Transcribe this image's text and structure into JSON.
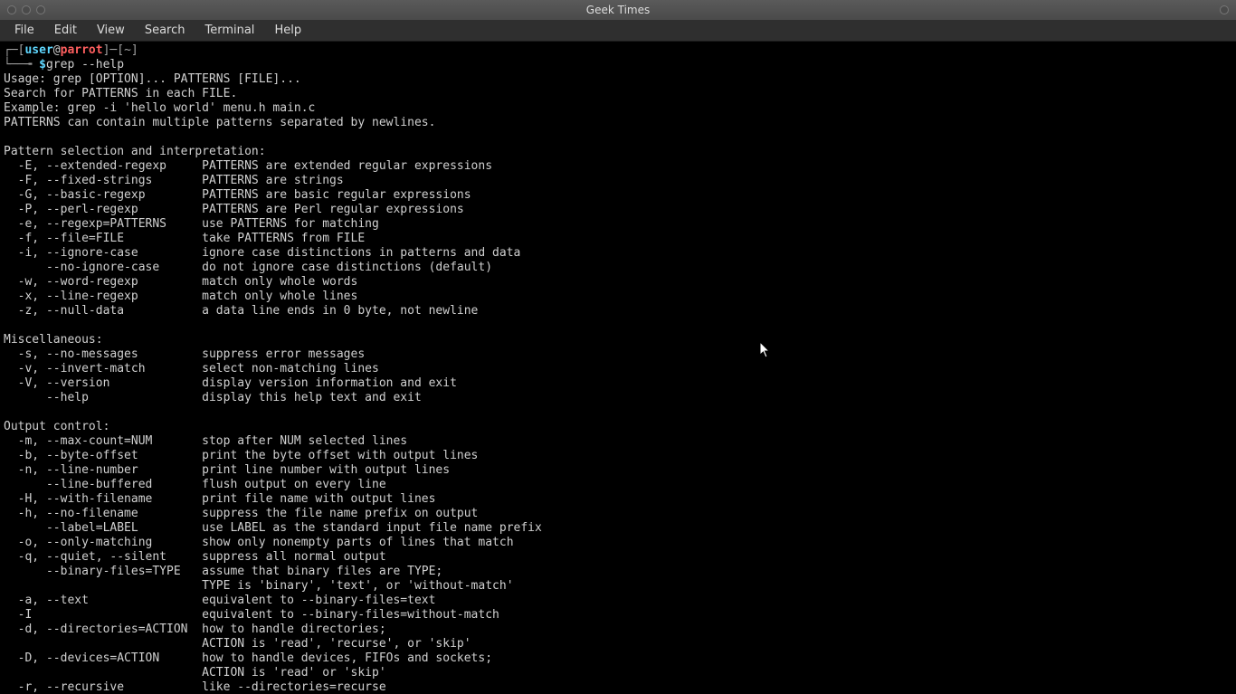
{
  "window": {
    "title": "Geek Times"
  },
  "menubar": {
    "items": [
      "File",
      "Edit",
      "View",
      "Search",
      "Terminal",
      "Help"
    ]
  },
  "prompt": {
    "lbracket": "┌─[",
    "user": "user",
    "at": "@",
    "host": "parrot",
    "rbracket_path": "]─[~]",
    "line2_prefix": "└──╼ ",
    "dollar": "$",
    "command": "grep --help"
  },
  "output": {
    "usage": "Usage: grep [OPTION]... PATTERNS [FILE]...",
    "search": "Search for PATTERNS in each FILE.",
    "example": "Example: grep -i 'hello world' menu.h main.c",
    "patterns_note": "PATTERNS can contain multiple patterns separated by newlines.",
    "section1_title": "Pattern selection and interpretation:",
    "section1": [
      "  -E, --extended-regexp     PATTERNS are extended regular expressions",
      "  -F, --fixed-strings       PATTERNS are strings",
      "  -G, --basic-regexp        PATTERNS are basic regular expressions",
      "  -P, --perl-regexp         PATTERNS are Perl regular expressions",
      "  -e, --regexp=PATTERNS     use PATTERNS for matching",
      "  -f, --file=FILE           take PATTERNS from FILE",
      "  -i, --ignore-case         ignore case distinctions in patterns and data",
      "      --no-ignore-case      do not ignore case distinctions (default)",
      "  -w, --word-regexp         match only whole words",
      "  -x, --line-regexp         match only whole lines",
      "  -z, --null-data           a data line ends in 0 byte, not newline"
    ],
    "section2_title": "Miscellaneous:",
    "section2": [
      "  -s, --no-messages         suppress error messages",
      "  -v, --invert-match        select non-matching lines",
      "  -V, --version             display version information and exit",
      "      --help                display this help text and exit"
    ],
    "section3_title": "Output control:",
    "section3": [
      "  -m, --max-count=NUM       stop after NUM selected lines",
      "  -b, --byte-offset         print the byte offset with output lines",
      "  -n, --line-number         print line number with output lines",
      "      --line-buffered       flush output on every line",
      "  -H, --with-filename       print file name with output lines",
      "  -h, --no-filename         suppress the file name prefix on output",
      "      --label=LABEL         use LABEL as the standard input file name prefix",
      "  -o, --only-matching       show only nonempty parts of lines that match",
      "  -q, --quiet, --silent     suppress all normal output",
      "      --binary-files=TYPE   assume that binary files are TYPE;",
      "                            TYPE is 'binary', 'text', or 'without-match'",
      "  -a, --text                equivalent to --binary-files=text",
      "  -I                        equivalent to --binary-files=without-match",
      "  -d, --directories=ACTION  how to handle directories;",
      "                            ACTION is 'read', 'recurse', or 'skip'",
      "  -D, --devices=ACTION      how to handle devices, FIFOs and sockets;",
      "                            ACTION is 'read' or 'skip'",
      "  -r, --recursive           like --directories=recurse"
    ]
  }
}
